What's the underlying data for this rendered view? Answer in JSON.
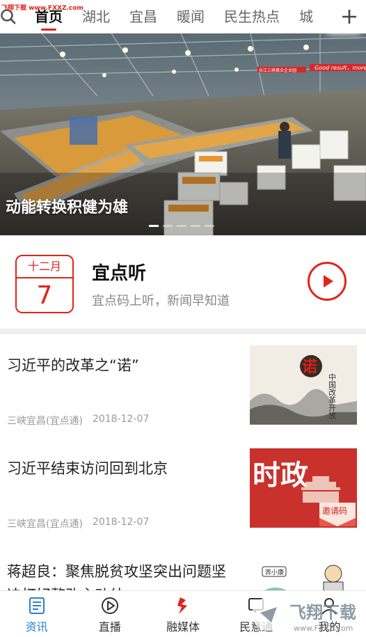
{
  "watermark": {
    "top_text": "飞翔下载 www.FXXZ.com",
    "bottom_text": "飞翔下载",
    "bottom_sub": "www.FXXZ.com"
  },
  "nav": {
    "tabs": [
      "首页",
      "湖北",
      "宜昌",
      "暖闻",
      "民生热点",
      "城"
    ],
    "active_index": 0
  },
  "banner": {
    "caption": "动能转换积健为雄",
    "page_count": 5,
    "active_dot": 0,
    "sign_text_1": "长江三峡果业企业园",
    "sign_text_2": "Good result，more"
  },
  "audio": {
    "month": "十二月",
    "day": "7",
    "title": "宜点听",
    "subtitle": "宜点码上听，新闻早知道"
  },
  "news": [
    {
      "title": "习近平的改革之“诺”",
      "source": "三峡宜昌(宜点通)",
      "date": "2018-12-07",
      "thumb": {
        "seal": "诺",
        "vertical": "中国改革开放"
      }
    },
    {
      "title": "习近平结束访问回到北京",
      "source": "三峡宜昌(宜点通)",
      "date": "2018-12-07",
      "thumb": {
        "big": "时政",
        "badge": "邀请码"
      }
    },
    {
      "title": "蒋超良：聚焦脱贫攻坚突出问题坚决打好整改主动仗",
      "source": "",
      "date": "",
      "thumb": {
        "label": "奔小康"
      }
    }
  ],
  "bottom_tabs": [
    {
      "label": "资讯",
      "icon": "news-icon",
      "active": true
    },
    {
      "label": "直播",
      "icon": "play-icon",
      "active": false
    },
    {
      "label": "融媒体",
      "icon": "media-icon",
      "active": false
    },
    {
      "label": "民意通",
      "icon": "opinion-icon",
      "active": false
    },
    {
      "label": "我的",
      "icon": "user-icon",
      "active": false
    }
  ],
  "colors": {
    "accent": "#e2231a",
    "tab_active": "#2a7fd4"
  }
}
